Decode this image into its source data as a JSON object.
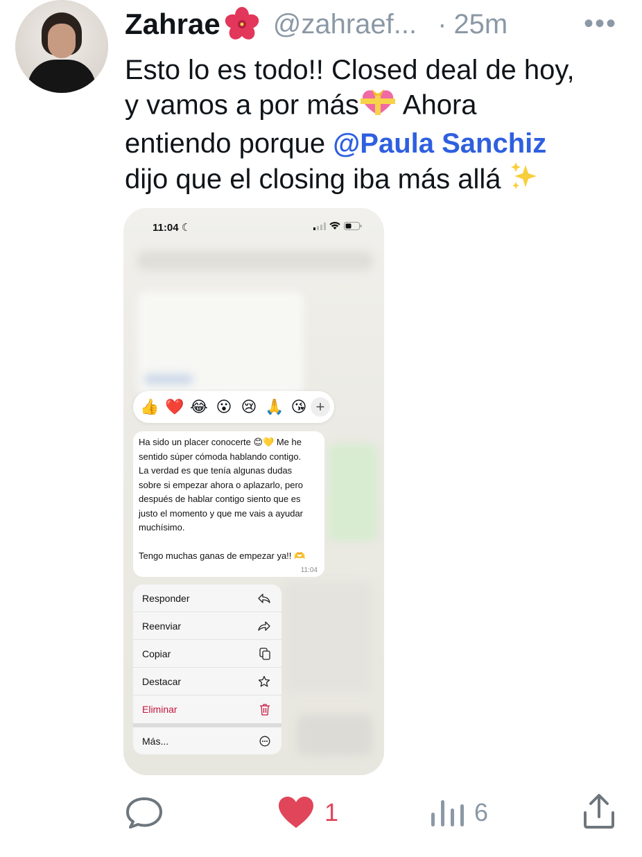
{
  "author": {
    "name": "Zahrae",
    "name_emoji": "hibiscus-emoji",
    "handle": "@zahraef...",
    "dot": "·",
    "time": "25m",
    "more_label": "•••"
  },
  "tweet": {
    "line1": "Esto lo es todo!! Closed deal de hoy,",
    "line2": "y vamos a por más",
    "line2b": " Ahora",
    "line3": "entiendo porque ",
    "mention": "@Paula Sanchiz",
    "line4": "dijo que el closing iba más allá "
  },
  "screenshot": {
    "status_time": "11:04",
    "reactions": [
      "👍",
      "❤️",
      "😂",
      "😮",
      "😢",
      "🙏",
      "😘"
    ],
    "reaction_more": "+",
    "message": "Ha sido un placer conocerte 😊💛 Me he\nsentido súper cómoda hablando contigo.\nLa verdad es que tenía algunas dudas\nsobre si empezar ahora o aplazarlo, pero\ndespués de hablar contigo siento que es\njusto el momento y que me vais a ayudar\nmuchísimo.\n\nTengo muchas ganas de empezar ya!! 🫶",
    "message_time": "11:04",
    "menu": {
      "reply": "Responder",
      "forward": "Reenviar",
      "copy": "Copiar",
      "star": "Destacar",
      "delete": "Eliminar",
      "more": "Más..."
    }
  },
  "actions": {
    "likes": "1",
    "views": "6"
  },
  "colors": {
    "mention": "#2f5fe0",
    "like": "#e0455a",
    "secondary": "#8b98a5",
    "danger": "#c4163f"
  }
}
